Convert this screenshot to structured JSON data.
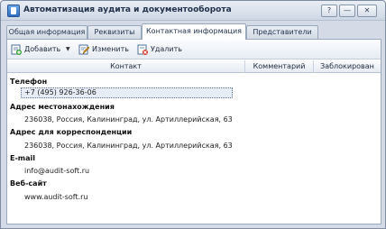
{
  "window": {
    "title": "Автоматизация аудита и документооборота",
    "help_label": "?",
    "minimize_label": "—",
    "close_label": "✕"
  },
  "tabs": [
    {
      "label": "Общая информация"
    },
    {
      "label": "Реквизиты"
    },
    {
      "label": "Контактная информация"
    },
    {
      "label": "Представители"
    }
  ],
  "toolbar": {
    "add_label": "Добавить",
    "edit_label": "Изменить",
    "delete_label": "Удалить"
  },
  "grid": {
    "columns": [
      "Контакт",
      "Комментарий",
      "Заблокирован"
    ],
    "groups": [
      {
        "name": "Телефон",
        "value": "+7 (495) 926-36-06"
      },
      {
        "name": "Адрес местонахождения",
        "value": "236038, Россия, Калининград, ул. Артиллерийская, 63"
      },
      {
        "name": "Адрес для корреспонденции",
        "value": "236038, Россия, Калининград, ул. Артиллерийская, 63"
      },
      {
        "name": "E-mail",
        "value": "info@audit-soft.ru"
      },
      {
        "name": "Веб-сайт",
        "value": "www.audit-soft.ru"
      }
    ]
  }
}
